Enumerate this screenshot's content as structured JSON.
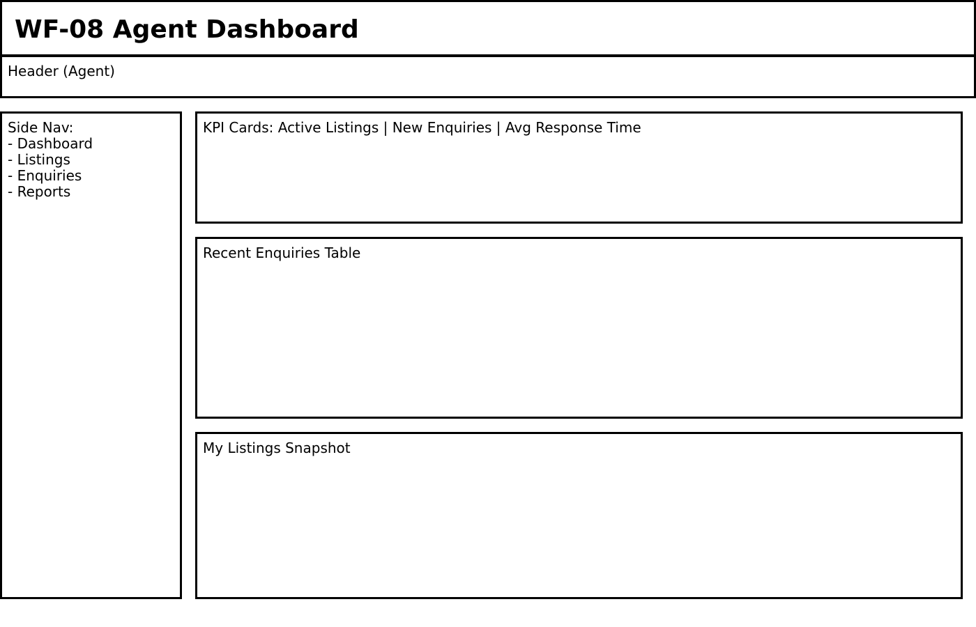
{
  "app": {
    "title": "WF-08 Agent Dashboard"
  },
  "header": {
    "label": "Header (Agent)"
  },
  "sidebar": {
    "heading": "Side Nav:",
    "items": [
      {
        "label": "- Dashboard"
      },
      {
        "label": "- Listings"
      },
      {
        "label": "- Enquiries"
      },
      {
        "label": "- Reports"
      }
    ]
  },
  "main": {
    "kpi_cards": {
      "label": "KPI Cards: Active Listings | New Enquiries | Avg Response Time"
    },
    "recent_enquiries": {
      "label": "Recent Enquiries Table"
    },
    "my_listings": {
      "label": "My Listings Snapshot"
    }
  }
}
